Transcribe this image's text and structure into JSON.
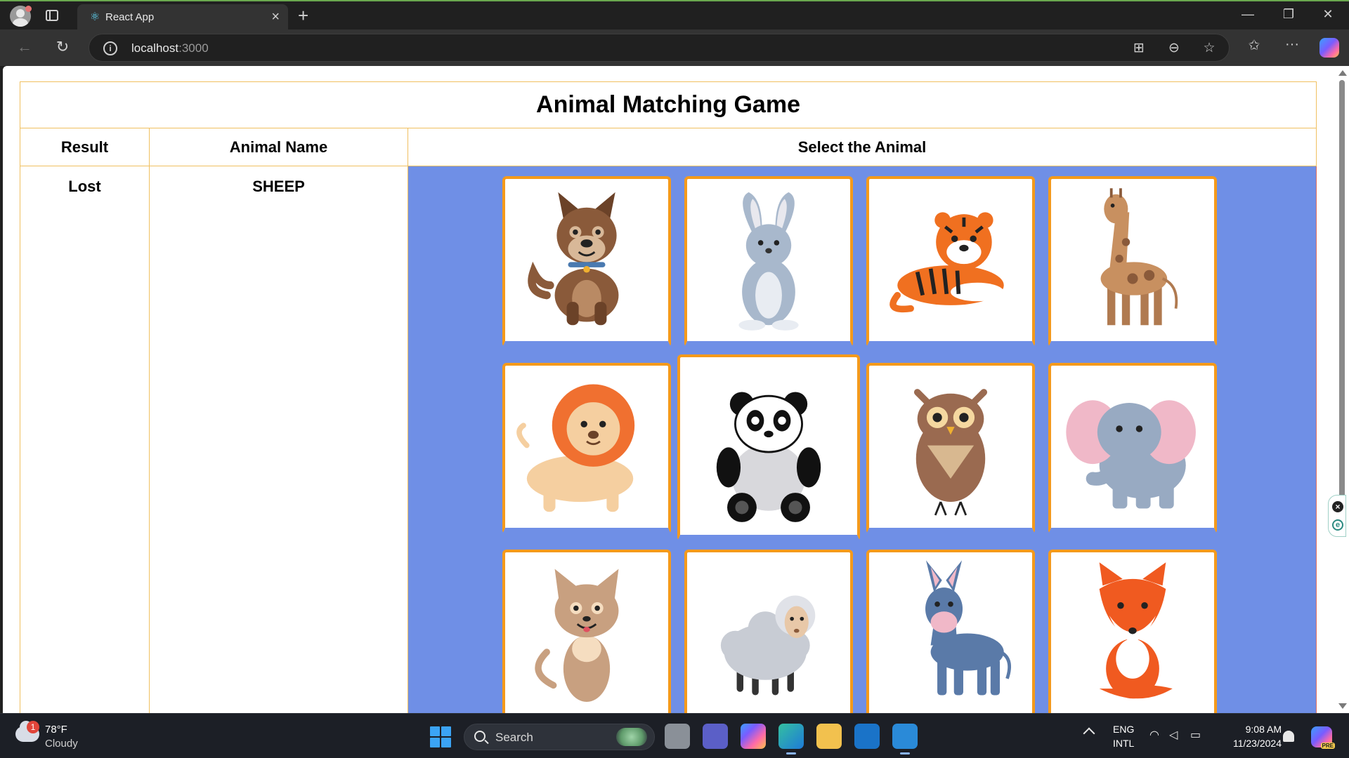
{
  "browser": {
    "tab_title": "React App",
    "url_host": "localhost",
    "url_port": ":3000"
  },
  "game": {
    "title": "Animal Matching Game",
    "headers": {
      "result": "Result",
      "animal_name": "Animal Name",
      "select": "Select the Animal"
    },
    "result": "Lost",
    "animal_name": "SHEEP",
    "cards": [
      {
        "animal": "dog-image"
      },
      {
        "animal": "rabbit-image"
      },
      {
        "animal": "tiger-image"
      },
      {
        "animal": "giraffe-image"
      },
      {
        "animal": "lion-image"
      },
      {
        "animal": "panda-image"
      },
      {
        "animal": "owl-image"
      },
      {
        "animal": "elephant-image"
      },
      {
        "animal": "cat-image"
      },
      {
        "animal": "sheep-image"
      },
      {
        "animal": "donkey-image"
      },
      {
        "animal": "fox-image"
      }
    ],
    "colors": {
      "grid_background": "#6f8fe6",
      "card_border": "#f59a1b",
      "table_border": "#f0c060"
    }
  },
  "taskbar": {
    "weather_badge": "1",
    "weather_temp": "78°F",
    "weather_desc": "Cloudy",
    "search_label": "Search",
    "lang_line1": "ENG",
    "lang_line2": "INTL",
    "time": "9:08 AM",
    "date": "11/23/2024",
    "copilot_badge": "PRE"
  }
}
